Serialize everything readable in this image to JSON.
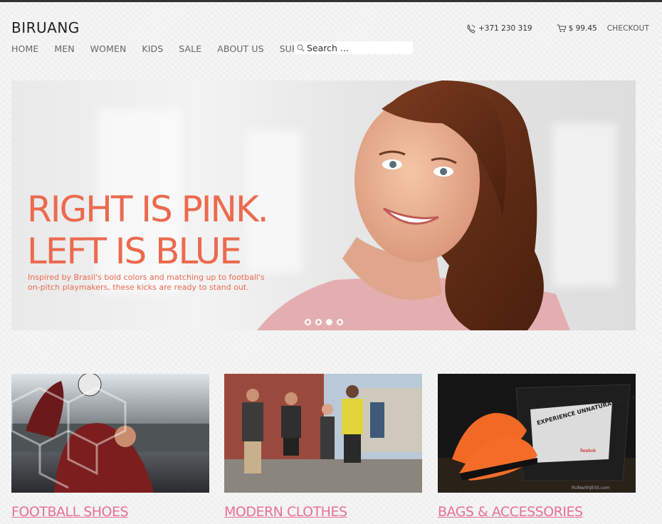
{
  "brand": "BIRUANG",
  "nav": {
    "items": [
      {
        "label": "HOME"
      },
      {
        "label": "MEN"
      },
      {
        "label": "WOMEN"
      },
      {
        "label": "KIDS"
      },
      {
        "label": "SALE"
      },
      {
        "label": "ABOUT US"
      },
      {
        "label": "SUPPORT"
      }
    ]
  },
  "search": {
    "placeholder": "Search ...",
    "icon": "search-icon"
  },
  "header_right": {
    "phone": "+371 230 319",
    "phone_icon": "phone-icon",
    "cart_total": "$ 99.45",
    "cart_icon": "cart-icon",
    "checkout_label": "CHECKOUT"
  },
  "hero": {
    "title_line1": "RIGHT IS PINK.",
    "title_line2": "LEFT IS BLUE",
    "subtitle": "Inspired by Brasil's bold colors and matching up to football's on-pitch playmakers, these kicks are ready to stand out.",
    "slides": 4,
    "active_slide": 3,
    "accent_color": "#ec6a4e"
  },
  "categories": [
    {
      "label": "FOOTBALL SHOES"
    },
    {
      "label": "MODERN CLOTHES"
    },
    {
      "label": "BAGS & ACCESSORIES",
      "image_text_1": "EXPERIENCE UNNATURAL QUICKNESS.",
      "image_text_2": "RUNwithJESS.com",
      "image_text_3": "Reebok"
    }
  ],
  "colors": {
    "category_link": "#e8709a",
    "background": "#f2f2f2"
  }
}
